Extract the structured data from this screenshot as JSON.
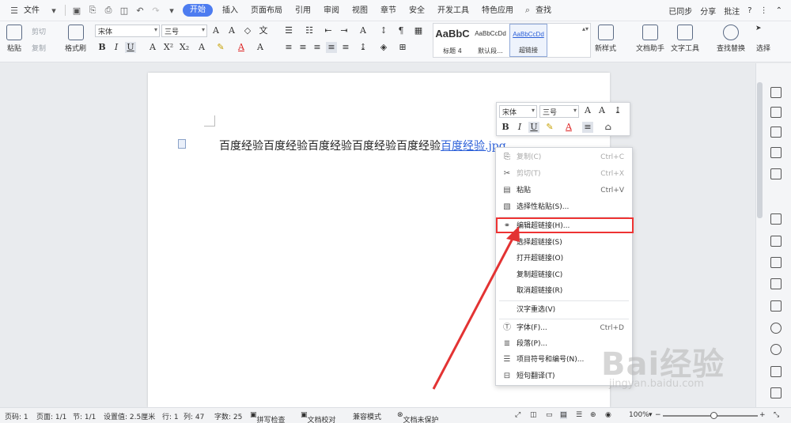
{
  "menubar": {
    "file": "文件",
    "tabs": [
      "开始",
      "插入",
      "页面布局",
      "引用",
      "审阅",
      "视图",
      "章节",
      "安全",
      "开发工具",
      "特色应用"
    ],
    "search": "查找",
    "right": [
      "已同步",
      "分享",
      "批注"
    ],
    "help": "?"
  },
  "toolbar": {
    "paste": "粘贴",
    "cut": "剪切",
    "copy": "复制",
    "format_painter": "格式刷",
    "font": "宋体",
    "size": "三号",
    "styles": [
      {
        "preview": "AaBbC",
        "label": "标题 4"
      },
      {
        "preview": "AaBbCcDd",
        "label": "默认段..."
      },
      {
        "preview": "AaBbCcDd",
        "label": "超链接"
      }
    ],
    "new_style": "新样式",
    "doc_assistant": "文档助手",
    "text_tools": "文字工具",
    "find_replace": "查找替换",
    "select": "选择"
  },
  "document": {
    "text": "百度经验百度经验百度经验百度经验百度经验",
    "link_text": "百度经验.jpg"
  },
  "mini_toolbar": {
    "font": "宋体",
    "size": "三号"
  },
  "context_menu": {
    "items": [
      {
        "label": "复制(C)",
        "shortcut": "Ctrl+C",
        "icon": "copy-icon",
        "disabled": true
      },
      {
        "label": "剪切(T)",
        "shortcut": "Ctrl+X",
        "icon": "cut-icon",
        "disabled": true
      },
      {
        "label": "粘贴",
        "shortcut": "Ctrl+V",
        "icon": "paste-icon",
        "disabled": false
      },
      {
        "label": "选择性粘贴(S)...",
        "shortcut": "",
        "icon": "paste-special-icon",
        "disabled": false
      },
      {
        "label": "编辑超链接(H)...",
        "shortcut": "",
        "icon": "link-icon",
        "disabled": false
      },
      {
        "label": "选择超链接(S)",
        "shortcut": "",
        "icon": "",
        "disabled": false
      },
      {
        "label": "打开超链接(O)",
        "shortcut": "",
        "icon": "",
        "disabled": false
      },
      {
        "label": "复制超链接(C)",
        "shortcut": "",
        "icon": "",
        "disabled": false
      },
      {
        "label": "取消超链接(R)",
        "shortcut": "",
        "icon": "",
        "disabled": false
      },
      {
        "label": "汉字重选(V)",
        "shortcut": "",
        "icon": "",
        "disabled": false
      },
      {
        "label": "字体(F)...",
        "shortcut": "Ctrl+D",
        "icon": "font-icon",
        "disabled": false
      },
      {
        "label": "段落(P)...",
        "shortcut": "",
        "icon": "paragraph-icon",
        "disabled": false
      },
      {
        "label": "项目符号和编号(N)...",
        "shortcut": "",
        "icon": "list-icon",
        "disabled": false
      },
      {
        "label": "短句翻译(T)",
        "shortcut": "",
        "icon": "translate-icon",
        "disabled": false
      }
    ]
  },
  "statusbar": {
    "page_num": "页码: 1",
    "pages": "页面: 1/1",
    "section": "节: 1/1",
    "setting": "设置值: 2.5厘米",
    "row": "行: 1",
    "col": "列: 47",
    "words": "字数: 25",
    "spell": "拼写检查",
    "proof": "文档校对",
    "compat": "兼容模式",
    "protect": "文档未保护",
    "zoom": "100%"
  },
  "watermark": {
    "brand": "Bai经验",
    "url": "jingyan.baidu.com"
  },
  "colors": {
    "accent": "#4d7cf0",
    "link": "#2b5fd8",
    "highlight": "#e33333"
  }
}
